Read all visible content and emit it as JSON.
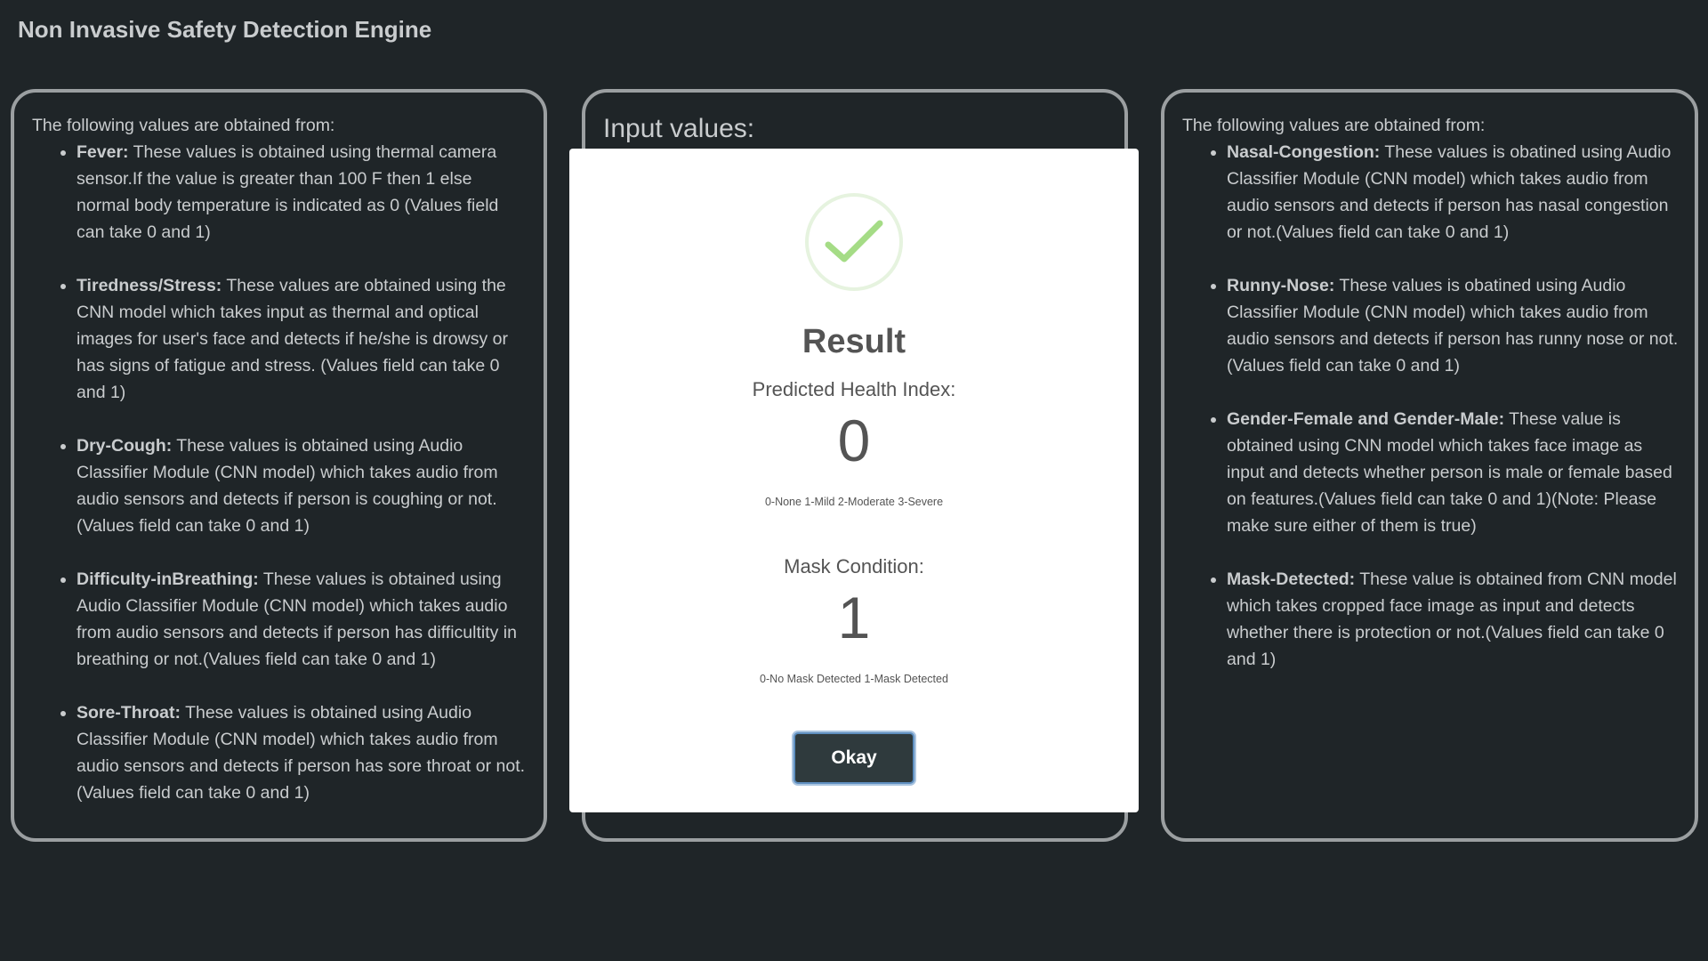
{
  "app": {
    "title": "Non Invasive Safety Detection Engine"
  },
  "left_panel": {
    "intro": "The following values are obtained from:",
    "items": [
      {
        "term": "Fever:",
        "text": " These values is obtained using thermal camera sensor.If the value is greater than 100 F then 1 else normal body temperature is indicated as 0 (Values field can take 0 and 1)"
      },
      {
        "term": "Tiredness/Stress:",
        "text": " These values are obtained using the CNN model which takes input as thermal and optical images for user's face and detects if he/she is drowsy or has signs of fatigue and stress. (Values field can take 0 and 1)"
      },
      {
        "term": "Dry-Cough:",
        "text": " These values is obtained using Audio Classifier Module (CNN model) which takes audio from audio sensors and detects if person is coughing or not.(Values field can take 0 and 1)"
      },
      {
        "term": "Difficulty-inBreathing:",
        "text": " These values is obtained using Audio Classifier Module (CNN model) which takes audio from audio sensors and detects if person has difficultity in breathing or not.(Values field can take 0 and 1)"
      },
      {
        "term": "Sore-Throat:",
        "text": " These values is obtained using Audio Classifier Module (CNN model) which takes audio from audio sensors and detects if person has sore throat or not.(Values field can take 0 and 1)"
      }
    ]
  },
  "middle_panel": {
    "title": "Input values:"
  },
  "right_panel": {
    "intro": "The following values are obtained from:",
    "items": [
      {
        "term": "Nasal-Congestion:",
        "text": " These values is obatined using Audio Classifier Module (CNN model) which takes audio from audio sensors and detects if person has nasal congestion or not.(Values field can take 0 and 1)"
      },
      {
        "term": "Runny-Nose:",
        "text": " These values is obatined using Audio Classifier Module (CNN model) which takes audio from audio sensors and detects if person has runny nose or not.(Values field can take 0 and 1)"
      },
      {
        "term": "Gender-Female and Gender-Male:",
        "text": " These value is obtained using CNN model which takes face image as input and detects whether person is male or female based on features.(Values field can take 0 and 1)(Note: Please make sure either of them is true)"
      },
      {
        "term": "Mask-Detected:",
        "text": " These value is obtained from CNN model which takes cropped face image as input and detects whether there is protection or not.(Values field can take 0 and 1)"
      }
    ]
  },
  "modal": {
    "icon": "success-check-icon",
    "title": "Result",
    "health_label": "Predicted Health Index:",
    "health_value": "0",
    "health_scale": "0-None 1-Mild 2-Moderate 3-Severe",
    "mask_label": "Mask Condition:",
    "mask_value": "1",
    "mask_scale": "0-No Mask Detected 1-Mask Detected",
    "button_label": "Okay",
    "colors": {
      "check": "#a5dc86",
      "button": "#2f3a3d"
    }
  }
}
